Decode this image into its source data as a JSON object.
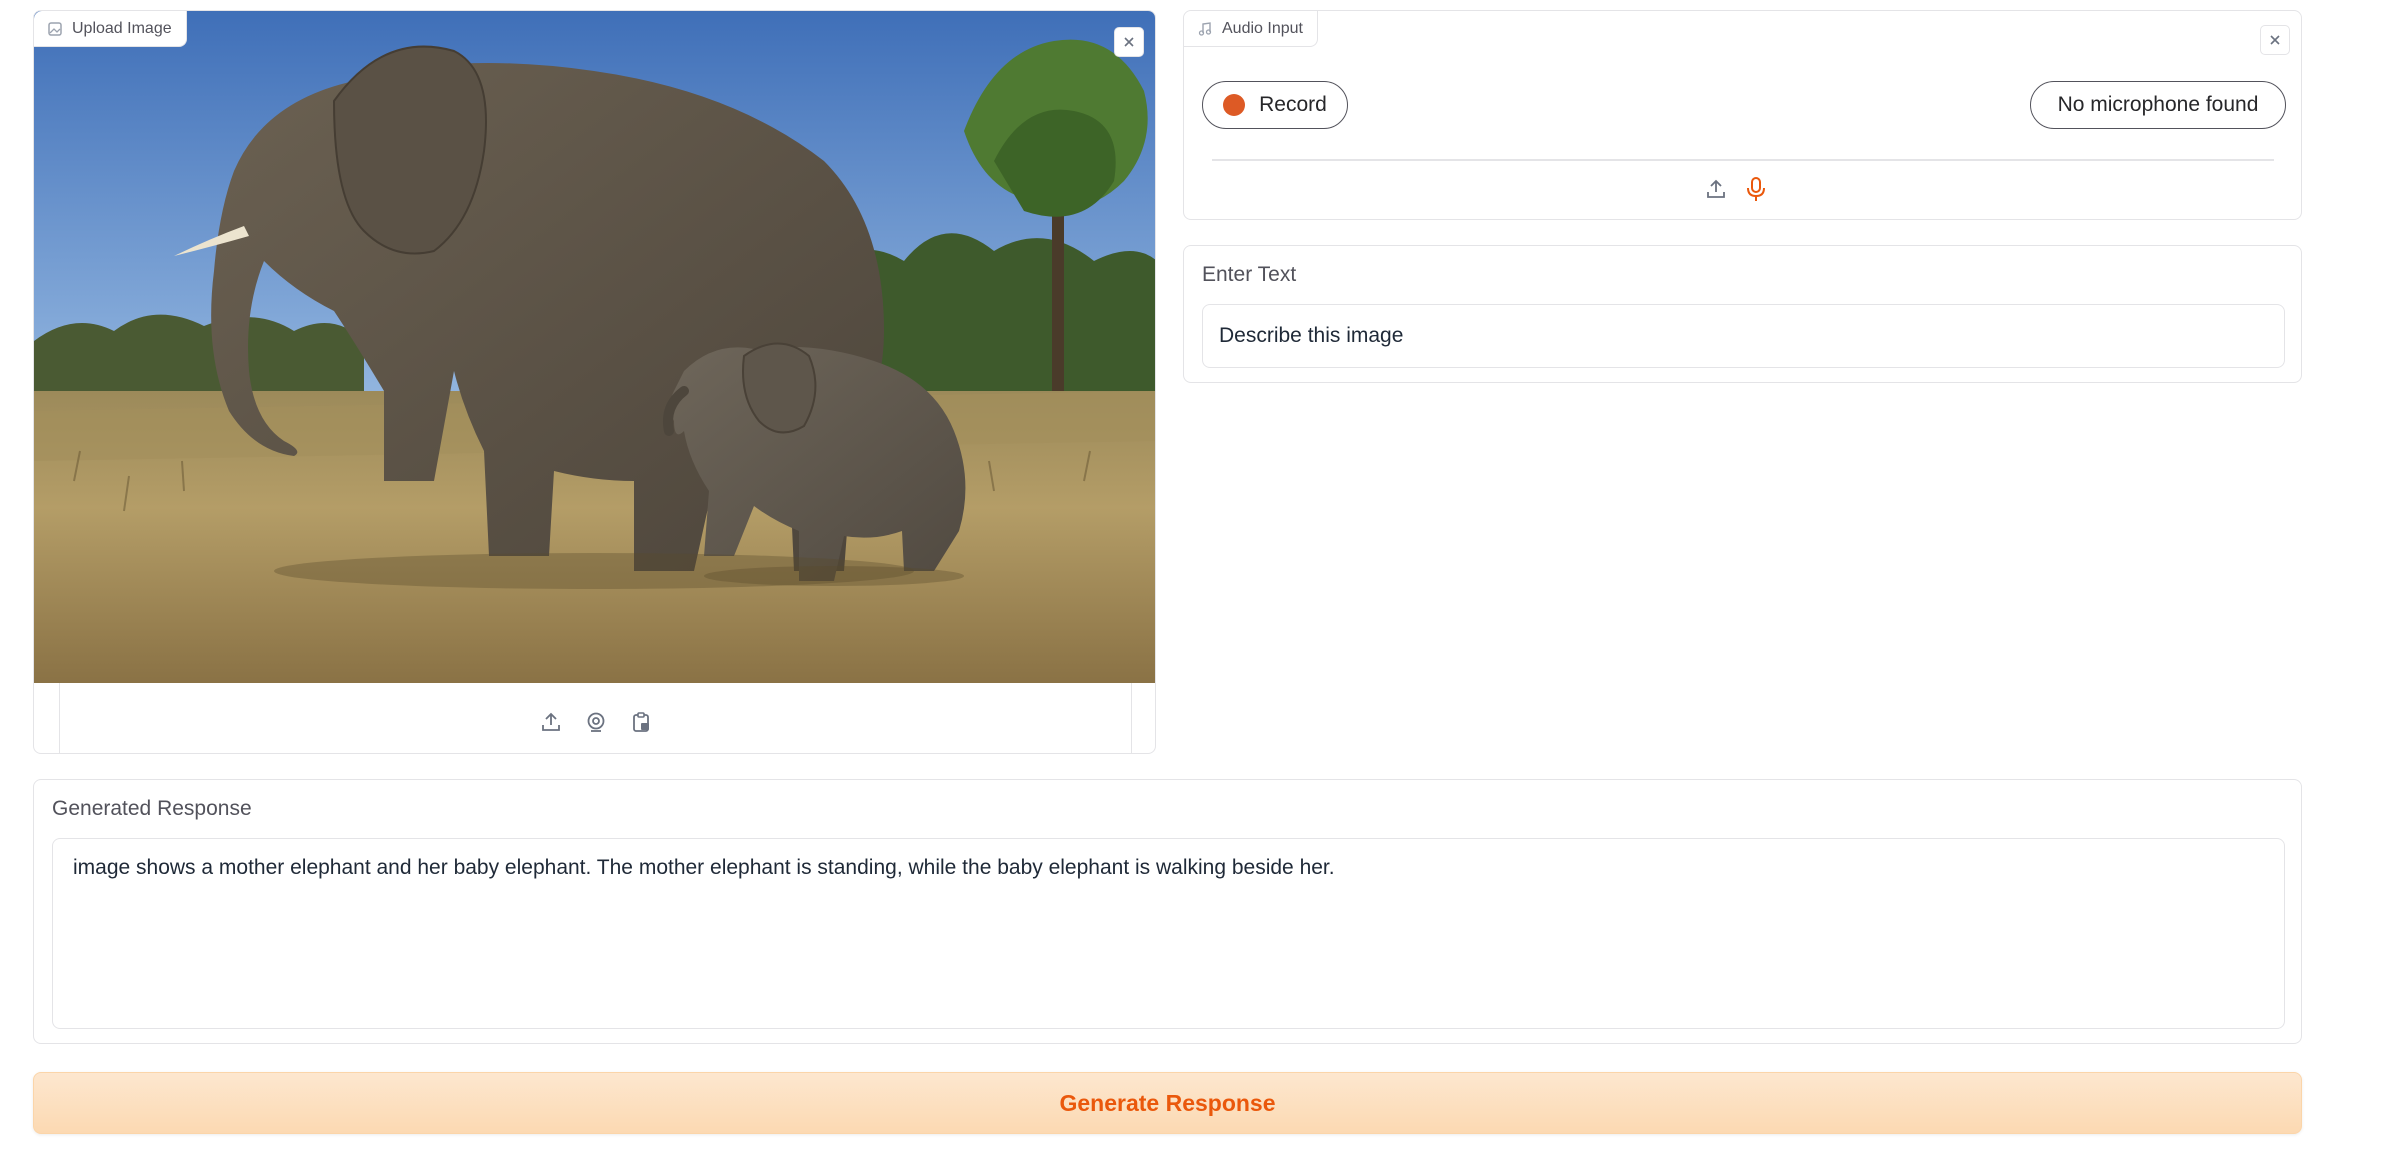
{
  "image_panel": {
    "tag_label": "Upload Image",
    "image_alt": "mother elephant and baby elephant on savanna"
  },
  "audio_panel": {
    "tag_label": "Audio Input",
    "record_label": "Record",
    "mic_status": "No microphone found"
  },
  "text_input": {
    "label": "Enter Text",
    "value": "Describe this image"
  },
  "response": {
    "label": "Generated Response",
    "value": "image shows a mother elephant and her baby elephant. The mother elephant is standing, while the baby elephant is walking beside her."
  },
  "generate_button": {
    "label": "Generate Response"
  },
  "colors": {
    "accent": "#ea580c",
    "record_dot": "#dd5a25",
    "border": "#e4e4e7",
    "button_bg": "#fde2c4"
  },
  "icons": [
    "image-icon",
    "close-icon",
    "upload-icon",
    "webcam-icon",
    "clipboard-icon",
    "music-note-icon",
    "microphone-icon"
  ]
}
